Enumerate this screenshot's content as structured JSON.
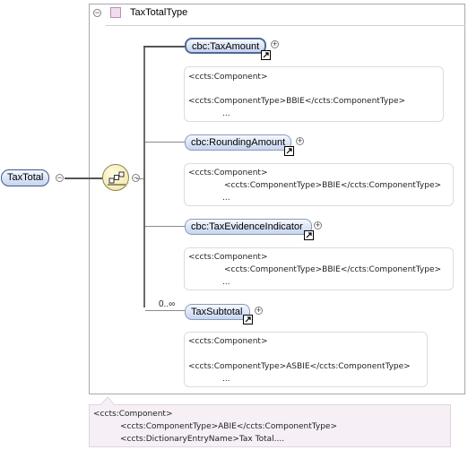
{
  "root": {
    "label": "TaxTotal"
  },
  "type": {
    "title": "TaxTotalType"
  },
  "elements": [
    {
      "label": "cbc:TaxAmount",
      "annotation": [
        "<ccts:Component>",
        "<ccts:ComponentType>BBIE</ccts:ComponentType>",
        "..."
      ]
    },
    {
      "label": "cbc:RoundingAmount",
      "annotation": [
        "<ccts:Component>",
        "<ccts:ComponentType>BBIE</ccts:ComponentType>",
        "..."
      ]
    },
    {
      "label": "cbc:TaxEvidenceIndicator",
      "annotation": [
        "<ccts:Component>",
        "<ccts:ComponentType>BBIE</ccts:ComponentType>",
        "..."
      ]
    },
    {
      "label": "TaxSubtotal",
      "multiplicity": "0..∞",
      "annotation": [
        "<ccts:Component>",
        "<ccts:ComponentType>ASBIE</ccts:ComponentType>",
        "..."
      ]
    }
  ],
  "root_annotation": [
    "<ccts:Component>",
    "<ccts:ComponentType>ABIE</ccts:ComponentType>",
    "<ccts:DictionaryEntryName>Tax Total...."
  ]
}
